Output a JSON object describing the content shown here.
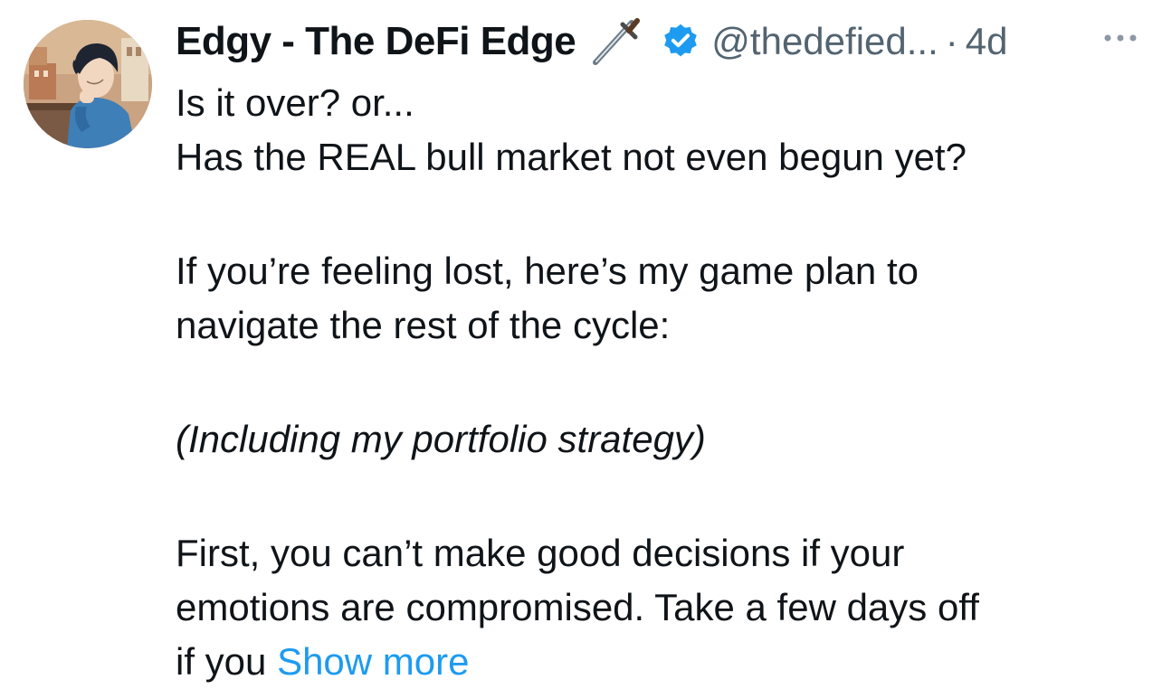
{
  "author": {
    "display_name": "Edgy - The DeFi Edge",
    "handle": "@thedefied...",
    "separator": "·",
    "time_ago": "4d",
    "verified_icon": "verified-badge-icon",
    "emoji_icon": "dagger-icon",
    "avatar_icon": "avatar",
    "colors": {
      "verified": "#1d9bf0",
      "meta": "#536471"
    }
  },
  "tweet": {
    "lines": [
      "Is it over? or...",
      "Has the REAL bull market not even begun yet?",
      "If you’re feeling lost, here’s my game plan to",
      "navigate the rest of the cycle:",
      "(Including my portfolio strategy)",
      "First, you can’t make good decisions if your",
      "emotions are compromised. Take a few days off",
      "if you"
    ],
    "show_more": "Show more",
    "colors": {
      "text": "#0f1419",
      "link": "#1d9bf0"
    }
  },
  "menu": {
    "icon": "more-horizontal-icon"
  }
}
